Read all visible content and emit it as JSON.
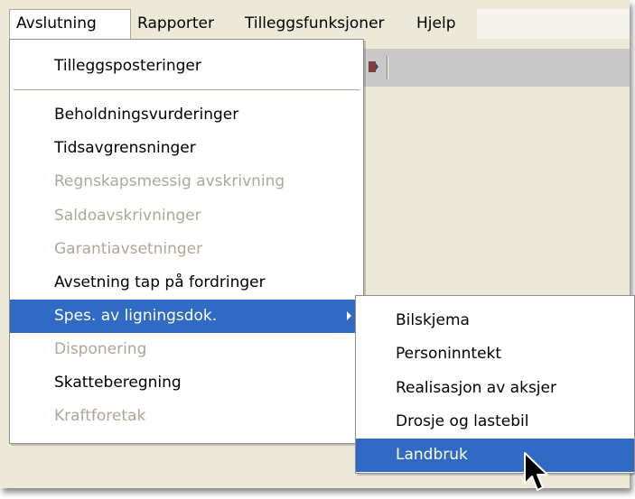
{
  "menubar": {
    "items": [
      {
        "label": "Avslutning",
        "open": true
      },
      {
        "label": "Rapporter"
      },
      {
        "label": "Tilleggsfunksjoner"
      },
      {
        "label": "Hjelp"
      }
    ]
  },
  "menu": {
    "items": [
      {
        "label": "Tilleggsposteringer",
        "enabled": true
      },
      {
        "label": "Beholdningsvurderinger",
        "enabled": true
      },
      {
        "label": "Tidsavgrensninger",
        "enabled": true
      },
      {
        "label": "Regnskapsmessig avskrivning",
        "enabled": false
      },
      {
        "label": "Saldoavskrivninger",
        "enabled": false
      },
      {
        "label": "Garantiavsetninger",
        "enabled": false
      },
      {
        "label": "Avsetning tap på fordringer",
        "enabled": true
      },
      {
        "label": "Spes. av ligningsdok.",
        "enabled": true,
        "highlighted": true,
        "has_submenu": true
      },
      {
        "label": "Disponering",
        "enabled": false
      },
      {
        "label": "Skatteberegning",
        "enabled": true
      },
      {
        "label": "Kraftforetak",
        "enabled": false
      }
    ]
  },
  "submenu": {
    "items": [
      {
        "label": "Bilskjema"
      },
      {
        "label": "Personinntekt"
      },
      {
        "label": "Realisasjon av aksjer"
      },
      {
        "label": "Drosje og lastebil"
      },
      {
        "label": "Landbruk",
        "highlighted": true
      }
    ]
  },
  "colors": {
    "highlight": "#316ac5",
    "disabled_text": "#aca899",
    "window_face": "#ece9d8",
    "toolbar": "#c8c8c8"
  },
  "icons": {
    "submenu_arrow": "triangle-right-icon",
    "cursor": "arrow-cursor-icon"
  }
}
